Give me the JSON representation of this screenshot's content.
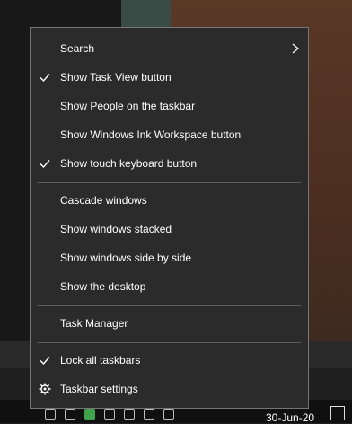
{
  "menu": {
    "items": [
      {
        "label": "Search",
        "checked": false,
        "submenu": true
      },
      {
        "label": "Show Task View button",
        "checked": true
      },
      {
        "label": "Show People on the taskbar",
        "checked": false
      },
      {
        "label": "Show Windows Ink Workspace button",
        "checked": false
      },
      {
        "label": "Show touch keyboard button",
        "checked": true
      },
      {
        "label": "Cascade windows",
        "checked": false
      },
      {
        "label": "Show windows stacked",
        "checked": false
      },
      {
        "label": "Show windows side by side",
        "checked": false
      },
      {
        "label": "Show the desktop",
        "checked": false
      },
      {
        "label": "Task Manager",
        "checked": false
      },
      {
        "label": "Lock all taskbars",
        "checked": true
      },
      {
        "label": "Taskbar settings",
        "icon": "gear-icon"
      }
    ]
  },
  "taskbar": {
    "date": "30-Jun-20"
  }
}
